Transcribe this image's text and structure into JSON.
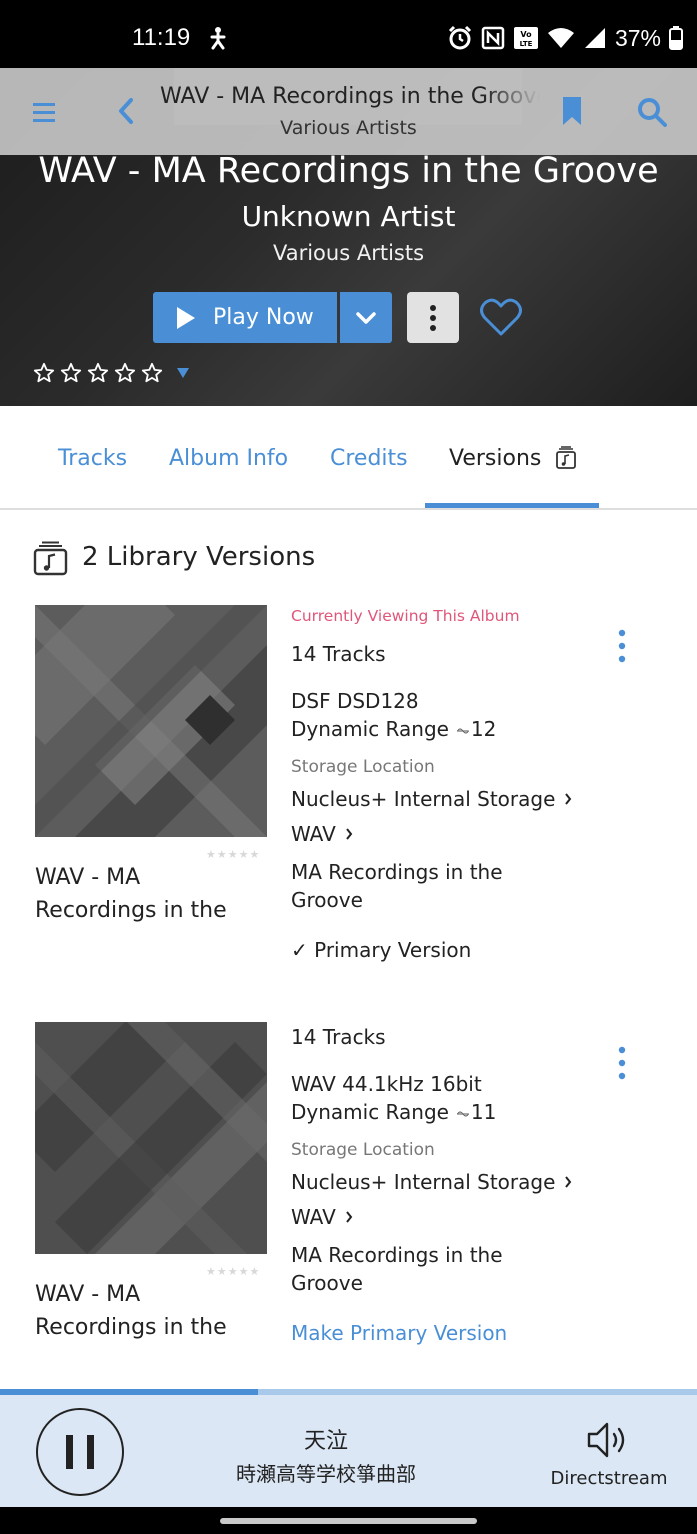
{
  "status_bar": {
    "time": "11:19",
    "battery_percent": "37%",
    "icons": [
      "alarm-icon",
      "nfc-icon",
      "volte-icon",
      "wifi-icon",
      "signal-icon",
      "battery-icon"
    ]
  },
  "top_bar": {
    "title": "WAV - MA Recordings in the Groove",
    "subtitle": "Various Artists"
  },
  "hero": {
    "title": "WAV - MA Recordings in the Groove",
    "artist": "Unknown Artist",
    "album_artist": "Various Artists",
    "play_label": "Play Now",
    "rating_stars": 5
  },
  "tabs": [
    {
      "label": "Tracks",
      "active": false
    },
    {
      "label": "Album Info",
      "active": false
    },
    {
      "label": "Credits",
      "active": false
    },
    {
      "label": "Versions",
      "active": true
    }
  ],
  "versions": {
    "heading": "2 Library Versions",
    "items": [
      {
        "album_name": "WAV - MA Recordings in the",
        "viewing_note": "Currently Viewing This Album",
        "tracks": "14 Tracks",
        "format": "DSF DSD128",
        "dynamic_range_label": "Dynamic Range",
        "dynamic_range_value": "12",
        "storage_label": "Storage Location",
        "storage_path": [
          "Nucleus+ Internal Storage",
          "WAV",
          "MA Recordings in the Groove"
        ],
        "primary_note": "✓ Primary Version"
      },
      {
        "album_name": "WAV - MA Recordings in the",
        "tracks": "14 Tracks",
        "format": "WAV 44.1kHz 16bit",
        "dynamic_range_label": "Dynamic Range",
        "dynamic_range_value": "11",
        "storage_label": "Storage Location",
        "storage_path": [
          "Nucleus+ Internal Storage",
          "WAV",
          "MA Recordings in the Groove"
        ],
        "action_label": "Make Primary Version"
      }
    ]
  },
  "player": {
    "track_title": "天泣",
    "track_artist": "時瀬高等学校箏曲部",
    "output_zone": "Directstream",
    "progress_fraction": 0.37
  },
  "colors": {
    "accent": "#4a8fd6",
    "pink": "#e0567a",
    "player_bg": "#dbe7f4"
  }
}
